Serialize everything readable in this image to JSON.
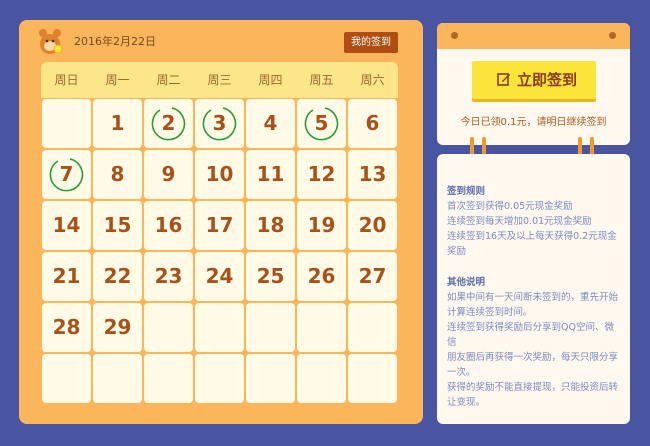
{
  "header": {
    "date": "2016年2月22日",
    "my_sign_label": "我的签到"
  },
  "weekdays": [
    "周日",
    "周一",
    "周二",
    "周三",
    "周四",
    "周五",
    "周六"
  ],
  "calendar": {
    "days": [
      "",
      "1",
      "2",
      "3",
      "4",
      "5",
      "6",
      "7",
      "8",
      "9",
      "10",
      "11",
      "12",
      "13",
      "14",
      "15",
      "16",
      "17",
      "18",
      "19",
      "20",
      "21",
      "22",
      "23",
      "24",
      "25",
      "26",
      "27",
      "28",
      "29",
      "",
      "",
      "",
      "",
      "",
      "",
      "",
      "",
      "",
      "",
      "",
      ""
    ],
    "signed_days": [
      "2",
      "3",
      "5",
      "7"
    ]
  },
  "sign": {
    "button_label": "立即签到",
    "note": "今日已领0.1元，请明日继续签到"
  },
  "rules": {
    "section1_title": "签到规则",
    "section1_lines": [
      "首次签到获得0.05元现金奖励",
      "连续签到每天增加0.01元现金奖励",
      "连续签到16天及以上每天获得0.2元现金",
      "奖励"
    ],
    "section2_title": "其他说明",
    "section2_lines": [
      "如果中间有一天间断未签到的，重先开始",
      "计算连续签到时间。",
      "连续签到获得奖励后分享到QQ空间、微信",
      "朋友圈后再获得一次奖励，每天只限分享",
      "一次。",
      "获得的奖励不能直接提现，只能投资后转",
      "让变现。"
    ]
  },
  "colors": {
    "background": "#4a55a2",
    "panel": "#fbb55a",
    "signed_circle": "#2a9d3a",
    "day_number": "#a8511a",
    "sign_button": "#fde43a"
  }
}
